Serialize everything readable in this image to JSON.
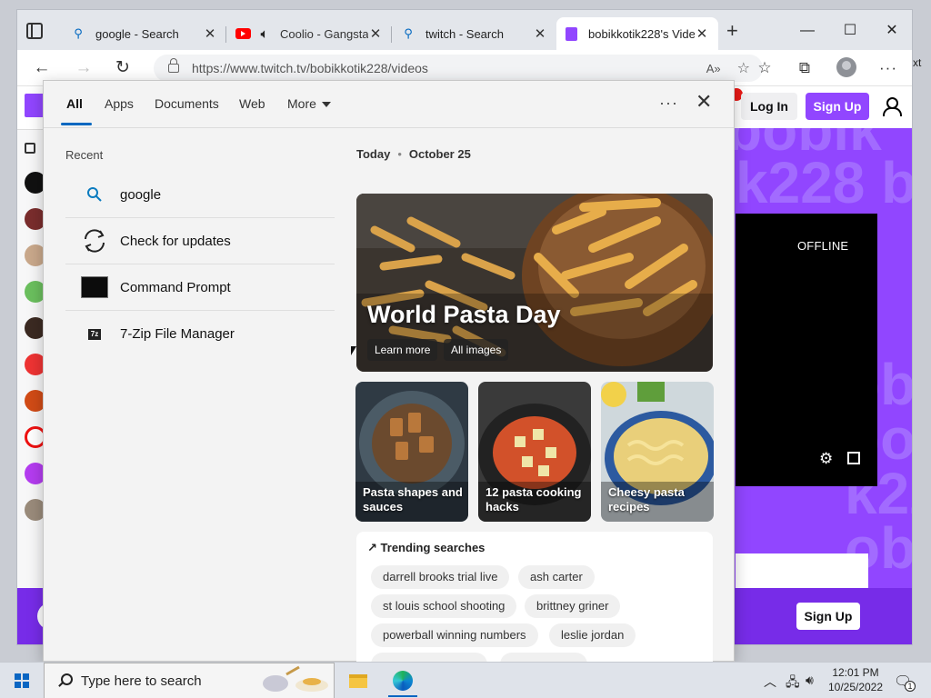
{
  "browser": {
    "tabs": [
      {
        "label": "google - Search",
        "icon": "search-icon"
      },
      {
        "label": "Coolio - Gangsta",
        "icon": "youtube-icon"
      },
      {
        "label": "twitch - Search",
        "icon": "search-icon"
      },
      {
        "label": "bobikkotik228's Videc",
        "icon": "twitch-icon",
        "active": true
      }
    ],
    "url": "https://www.twitch.tv/bobikkotik228/videos",
    "read_aloud": "A»",
    "right_edge_text": "xt"
  },
  "twitch": {
    "login": "Log In",
    "signup": "Sign Up",
    "offline": "OFFLINE",
    "watermark_lines": [
      "bobik",
      "k228 b",
      "obik",
      "bobik",
      "k228 b",
      "obik",
      "bobik"
    ],
    "bottom_signup": "Sign Up",
    "brand_color": "#9146ff"
  },
  "search_panel": {
    "tabs": [
      "All",
      "Apps",
      "Documents",
      "Web",
      "More"
    ],
    "active_tab": "All",
    "recent_heading": "Recent",
    "recent": [
      {
        "label": "google",
        "icon": "search-icon"
      },
      {
        "label": "Check for updates",
        "icon": "refresh-icon"
      },
      {
        "label": "Command Prompt",
        "icon": "command-prompt-icon"
      },
      {
        "label": "7-Zip File Manager",
        "icon": "7zip-icon"
      }
    ],
    "date_today": "Today",
    "date_label": "October 25",
    "hero": {
      "title": "World Pasta Day",
      "learn_more": "Learn more",
      "all_images": "All images"
    },
    "cards": [
      {
        "label": "Pasta shapes and sauces"
      },
      {
        "label": "12 pasta cooking hacks"
      },
      {
        "label": "Cheesy pasta recipes"
      }
    ],
    "trending_heading": "Trending searches",
    "trending": [
      "darrell brooks trial live",
      "ash carter",
      "st louis school shooting",
      "brittney griner",
      "powerball winning numbers",
      "leslie jordan"
    ]
  },
  "taskbar": {
    "search_placeholder": "Type here to search",
    "time": "12:01 PM",
    "date": "10/25/2022",
    "notification_count": "1"
  }
}
